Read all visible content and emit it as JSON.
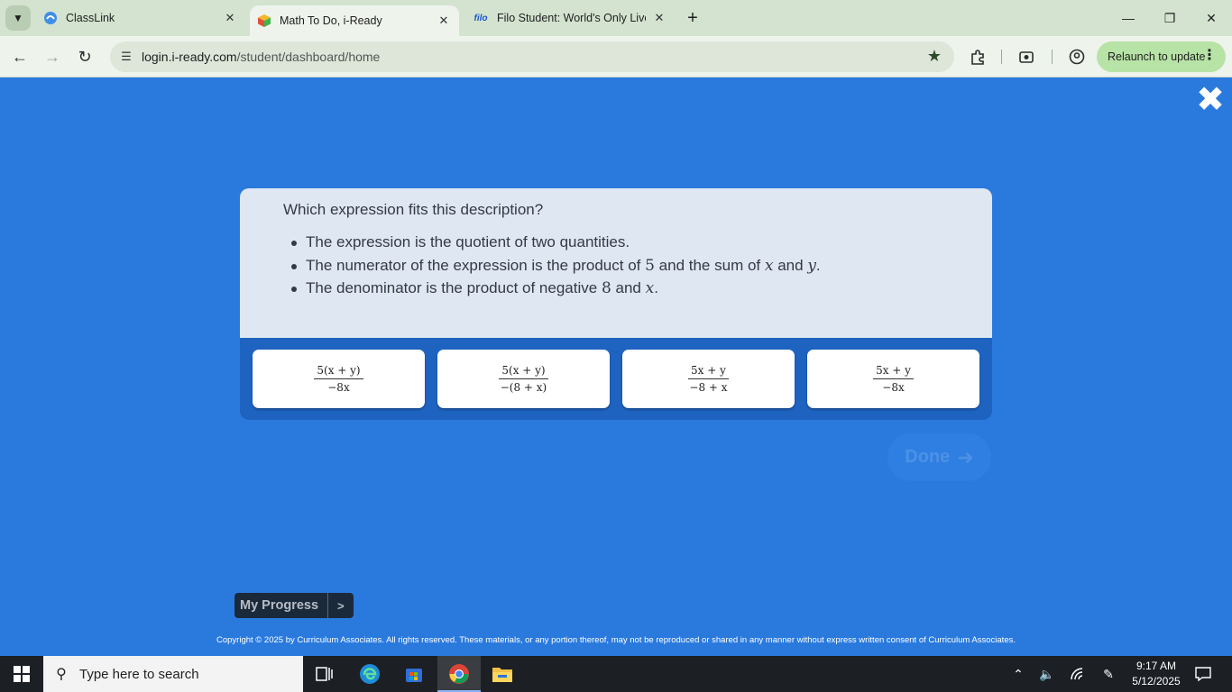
{
  "browser": {
    "tabs": [
      {
        "title": "ClassLink",
        "favicon": "classlink-icon"
      },
      {
        "title": "Math To Do, i-Ready",
        "favicon": "iready-cube-icon",
        "active": true
      },
      {
        "title": "Filo Student: World's Only Live",
        "favicon": "filo-icon",
        "favicon_text": "filo"
      }
    ],
    "url_domain": "login.i-ready.com",
    "url_path": "/student/dashboard/home",
    "relaunch_label": "Relaunch to update"
  },
  "lesson": {
    "question": "Which expression fits this description?",
    "bullets": [
      {
        "before": "The expression is the quotient of two quantities.",
        "parts": []
      },
      {
        "text": "The numerator of the expression is the product of",
        "v1": "5",
        "mid": "and the sum of",
        "v2": "x",
        "mid2": "and",
        "v3": "y",
        "end": "."
      },
      {
        "text": "The denominator is the product of negative",
        "v1": "8",
        "mid": "and",
        "v2": "x",
        "end": "."
      }
    ],
    "choices": [
      {
        "numerator": "5(x + y)",
        "denominator": "−8x"
      },
      {
        "numerator": "5(x + y)",
        "denominator": "−(8 + x)"
      },
      {
        "numerator": "5x + y",
        "denominator": "−8 + x"
      },
      {
        "numerator": "5x + y",
        "denominator": "−8x"
      }
    ],
    "done_label": "Done",
    "done_icon": "arrow-right-icon",
    "my_progress_label": "My Progress",
    "my_progress_arrow": ">",
    "copyright": "Copyright © 2025 by Curriculum Associates. All rights reserved. These materials, or any portion thereof, may not be reproduced or shared in any manner without express written consent of Curriculum Associates."
  },
  "taskbar": {
    "search_placeholder": "Type here to search",
    "time": "9:17 AM",
    "date": "5/12/2025"
  },
  "colors": {
    "page_bg": "#2a7ade",
    "card_top": "#dfe7f2",
    "card_bottom": "#1e63c0",
    "relaunch_bg": "#b7e3a6",
    "tab_strip": "#d3e3cf"
  }
}
